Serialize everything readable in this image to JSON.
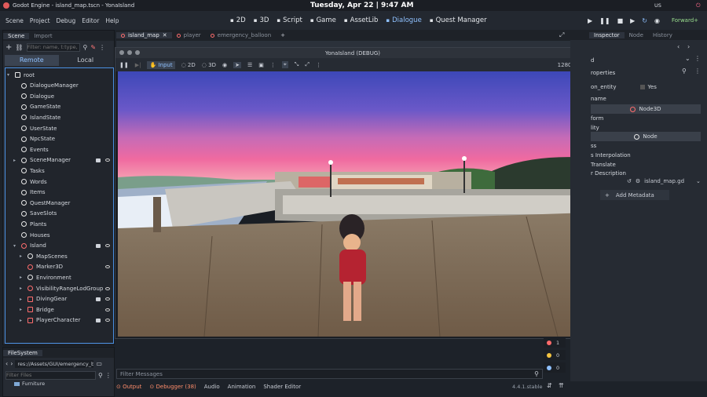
{
  "topbar": {
    "app_title": "Godot Engine - island_map.tscn - YonaIsland",
    "clock": "Tuesday, Apr 22 | 9:47 AM",
    "locale": "US"
  },
  "menu": {
    "items": [
      "Scene",
      "Project",
      "Debug",
      "Editor",
      "Help"
    ]
  },
  "workspaces": [
    {
      "label": "2D",
      "icon": "2d-icon"
    },
    {
      "label": "3D",
      "icon": "3d-icon"
    },
    {
      "label": "Script",
      "icon": "script-icon"
    },
    {
      "label": "Game",
      "icon": "game-icon"
    },
    {
      "label": "AssetLib",
      "icon": "assetlib-icon"
    },
    {
      "label": "Dialogue",
      "icon": "dialogue-icon",
      "active": true
    },
    {
      "label": "Quest Manager",
      "icon": "quest-icon"
    }
  ],
  "renderer": "Forward+",
  "scene_panel": {
    "tabs": [
      "Scene",
      "Import"
    ],
    "filter_placeholder": "Filter: name, t:type,",
    "remote": "Remote",
    "local": "Local",
    "nodes": [
      {
        "label": "root",
        "depth": 0,
        "arrow": "down",
        "icon": "square"
      },
      {
        "label": "DialogueManager",
        "depth": 1
      },
      {
        "label": "Dialogue",
        "depth": 1
      },
      {
        "label": "GameState",
        "depth": 1
      },
      {
        "label": "IslandState",
        "depth": 1
      },
      {
        "label": "UserState",
        "depth": 1
      },
      {
        "label": "NpcState",
        "depth": 1
      },
      {
        "label": "Events",
        "depth": 1
      },
      {
        "label": "SceneManager",
        "depth": 1,
        "arrow": "right",
        "film": true,
        "eye": true
      },
      {
        "label": "Tasks",
        "depth": 1
      },
      {
        "label": "Words",
        "depth": 1
      },
      {
        "label": "Items",
        "depth": 1
      },
      {
        "label": "QuestManager",
        "depth": 1
      },
      {
        "label": "SaveSlots",
        "depth": 1
      },
      {
        "label": "Plants",
        "depth": 1
      },
      {
        "label": "Houses",
        "depth": 1
      },
      {
        "label": "Island",
        "depth": 1,
        "arrow": "down",
        "red": true,
        "film": true,
        "eye": true
      },
      {
        "label": "MapScenes",
        "depth": 2,
        "arrow": "right"
      },
      {
        "label": "Marker3D",
        "depth": 2,
        "red": true,
        "eye": true
      },
      {
        "label": "Environment",
        "depth": 2,
        "arrow": "right"
      },
      {
        "label": "VisibilityRangeLodGroup",
        "depth": 2,
        "arrow": "right",
        "red": true,
        "eye": true
      },
      {
        "label": "DivingGear",
        "depth": 2,
        "arrow": "right",
        "red": true,
        "sq": true,
        "film": true,
        "eye": true
      },
      {
        "label": "Bridge",
        "depth": 2,
        "arrow": "right",
        "red": true,
        "sq": true,
        "eye": true
      },
      {
        "label": "PlayerCharacter",
        "depth": 2,
        "arrow": "right",
        "red": true,
        "sq": true,
        "film": true,
        "eye": true
      }
    ]
  },
  "filesystem": {
    "title": "FileSystem",
    "path": "res://Assets/GUI/emergency_b",
    "filter_placeholder": "Filter Files",
    "folder": "Furniture"
  },
  "editor_tabs": [
    {
      "label": "island_map",
      "active": true
    },
    {
      "label": "player"
    },
    {
      "label": "emergency_balloon"
    }
  ],
  "game_window": {
    "title": "YonaIsland (DEBUG)",
    "resolution": "1280x720",
    "toolbar": {
      "input": "Input",
      "mode2d": "2D",
      "mode3d": "3D"
    }
  },
  "inspector": {
    "tabs": [
      "Inspector",
      "Node",
      "History"
    ],
    "rows": [
      {
        "label": "d"
      },
      {
        "label": "roperties"
      },
      {
        "label": "on_entity",
        "value": "Yes"
      },
      {
        "label": "name"
      },
      {
        "label": "Node3D",
        "header": true
      },
      {
        "label": "form"
      },
      {
        "label": "lity"
      },
      {
        "label": "Node",
        "header": true
      },
      {
        "label": "ss"
      },
      {
        "label": "s Interpolation"
      },
      {
        "label": "Translate"
      },
      {
        "label": "r Description"
      }
    ],
    "script": "island_map.gd",
    "add_metadata": "Add Metadata"
  },
  "debugger_badges": [
    "1",
    "0",
    "0"
  ],
  "bottom": {
    "filter_messages": "Filter Messages",
    "output": "Output",
    "debugger": "Debugger (38)",
    "audio": "Audio",
    "animation": "Animation",
    "shader": "Shader Editor",
    "version": "4.4.1.stable"
  }
}
